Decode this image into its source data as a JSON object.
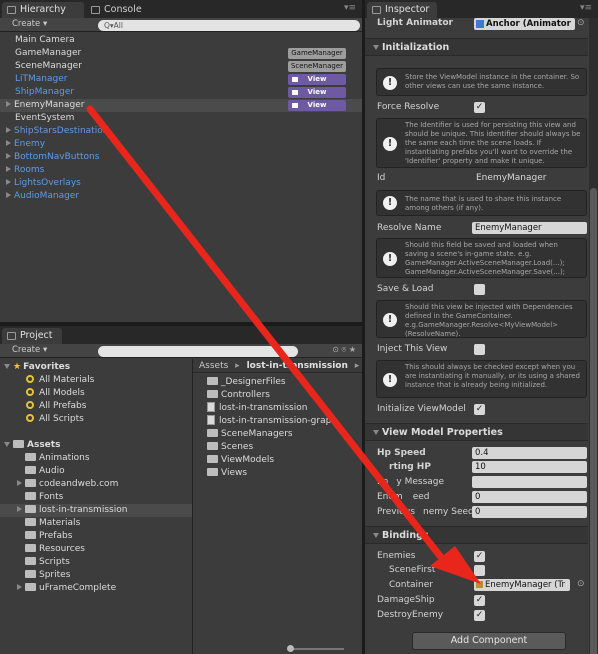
{
  "hierarchy": {
    "tab": "Hierarchy",
    "console_tab": "Console",
    "create": "Create ▾",
    "search": "Q▾All",
    "items": [
      {
        "label": "Main Camera",
        "color": "white"
      },
      {
        "label": "GameManager",
        "color": "white",
        "tag": "GameManager",
        "tag_style": "gray"
      },
      {
        "label": "SceneManager",
        "color": "white",
        "tag": "SceneManager",
        "tag_style": "gray"
      },
      {
        "label": "LiTManager",
        "color": "blue",
        "tag": "View",
        "tag_style": "purple"
      },
      {
        "label": "ShipManager",
        "color": "blue",
        "tag": "View",
        "tag_style": "purple"
      },
      {
        "label": "EnemyManager",
        "color": "white",
        "tag": "View",
        "tag_style": "purple",
        "selected": true,
        "fold": true
      },
      {
        "label": "EventSystem",
        "color": "white"
      },
      {
        "label": "ShipStarsDestination",
        "color": "blue",
        "fold": true
      },
      {
        "label": "Enemy",
        "color": "blue",
        "fold": true
      },
      {
        "label": "BottomNavButtons",
        "color": "blue",
        "fold": true
      },
      {
        "label": "Rooms",
        "color": "blue",
        "fold": true
      },
      {
        "label": "LightsOverlays",
        "color": "blue",
        "fold": true
      },
      {
        "label": "AudioManager",
        "color": "blue",
        "fold": true
      }
    ]
  },
  "project": {
    "tab": "Project",
    "create": "Create ▾",
    "favorites_label": "Favorites",
    "favorites": [
      "All Materials",
      "All Models",
      "All Prefabs",
      "All Scripts"
    ],
    "assets_label": "Assets",
    "assets": [
      {
        "label": "Animations"
      },
      {
        "label": "Audio"
      },
      {
        "label": "codeandweb.com",
        "fold": true
      },
      {
        "label": "Fonts"
      },
      {
        "label": "lost-in-transmission",
        "fold": true,
        "selected": true
      },
      {
        "label": "Materials"
      },
      {
        "label": "Prefabs"
      },
      {
        "label": "Resources"
      },
      {
        "label": "Scripts"
      },
      {
        "label": "Sprites"
      },
      {
        "label": "uFrameComplete",
        "fold": true
      }
    ],
    "breadcrumb_root": "Assets",
    "breadcrumb_sep": "▸",
    "breadcrumb_folder": "lost-in-transmission",
    "contents": [
      {
        "label": "_DesignerFiles",
        "kind": "folder"
      },
      {
        "label": "Controllers",
        "kind": "folder"
      },
      {
        "label": "lost-in-transmission",
        "kind": "file"
      },
      {
        "label": "lost-in-transmission-grap",
        "kind": "file"
      },
      {
        "label": "SceneManagers",
        "kind": "folder"
      },
      {
        "label": "Scenes",
        "kind": "folder"
      },
      {
        "label": "ViewModels",
        "kind": "folder"
      },
      {
        "label": "Views",
        "kind": "folder"
      }
    ]
  },
  "inspector": {
    "tab": "Inspector",
    "light_animator_label": "Light Animator",
    "light_animator_value": "Anchor (Animator",
    "init_section": "Initialization",
    "help_container": "Store the ViewModel instance in the container. So other views can use the same instance.",
    "force_resolve_label": "Force Resolve",
    "help_identifier": "The Identifier is used for persisting this view and should be unique. This identifier should always be the same each time the scene loads. If instantiating prefabs you'll want to override the 'Identifier' property and make it unique.",
    "id_label": "Id",
    "id_value": "EnemyManager",
    "help_name": "The name that is used to share this instance among others (if any).",
    "resolve_name_label": "Resolve Name",
    "resolve_name_value": "EnemyManager",
    "help_save": "Should this field be saved and loaded when saving a scene's in-game state. e.g. GameManager.ActiveSceneManager.Load(...); GameManager.ActiveSceneManager.Save(...);",
    "save_load_label": "Save & Load",
    "help_inject": "Should this view be injected with Dependencies defined in the GameContainer. e.g.GameManager.Resolve<MyViewModel>(ResolveName).",
    "inject_label": "Inject This View",
    "help_instantiate": "This should always be checked except when you are instantiating it manually, or its using a shared instance that is already being initialized.",
    "init_vm_label": "Initialize ViewModel",
    "vm_section": "View Model Properties",
    "hp_speed_label": "Hp Speed",
    "hp_speed_value": "0.4",
    "starting_hp_label": "rting HP",
    "starting_hp_value": "10",
    "enemy_message_label": "En",
    "enemy_message_suffix": "y Message",
    "enemy_speed_label": "Enem",
    "enemy_speed_suffix": "eed",
    "enemy_speed_value": "0",
    "prev_enemy_label": "Previous",
    "prev_enemy_suffix": "nemy Seed",
    "prev_enemy_value": "0",
    "bindings_section": "Bindings",
    "enemies_label": "Enemies",
    "scene_first_label": "SceneFirst",
    "container_label": "Container",
    "container_value": "EnemyManager (Tr",
    "damage_ship_label": "DamageShip",
    "destroy_enemy_label": "DestroyEnemy",
    "add_component": "Add Component",
    "check": "✓"
  },
  "colors": {
    "arrow": "#e8261c",
    "accent_blue": "#5d9bea",
    "tag_purple": "#6d5aa3"
  }
}
